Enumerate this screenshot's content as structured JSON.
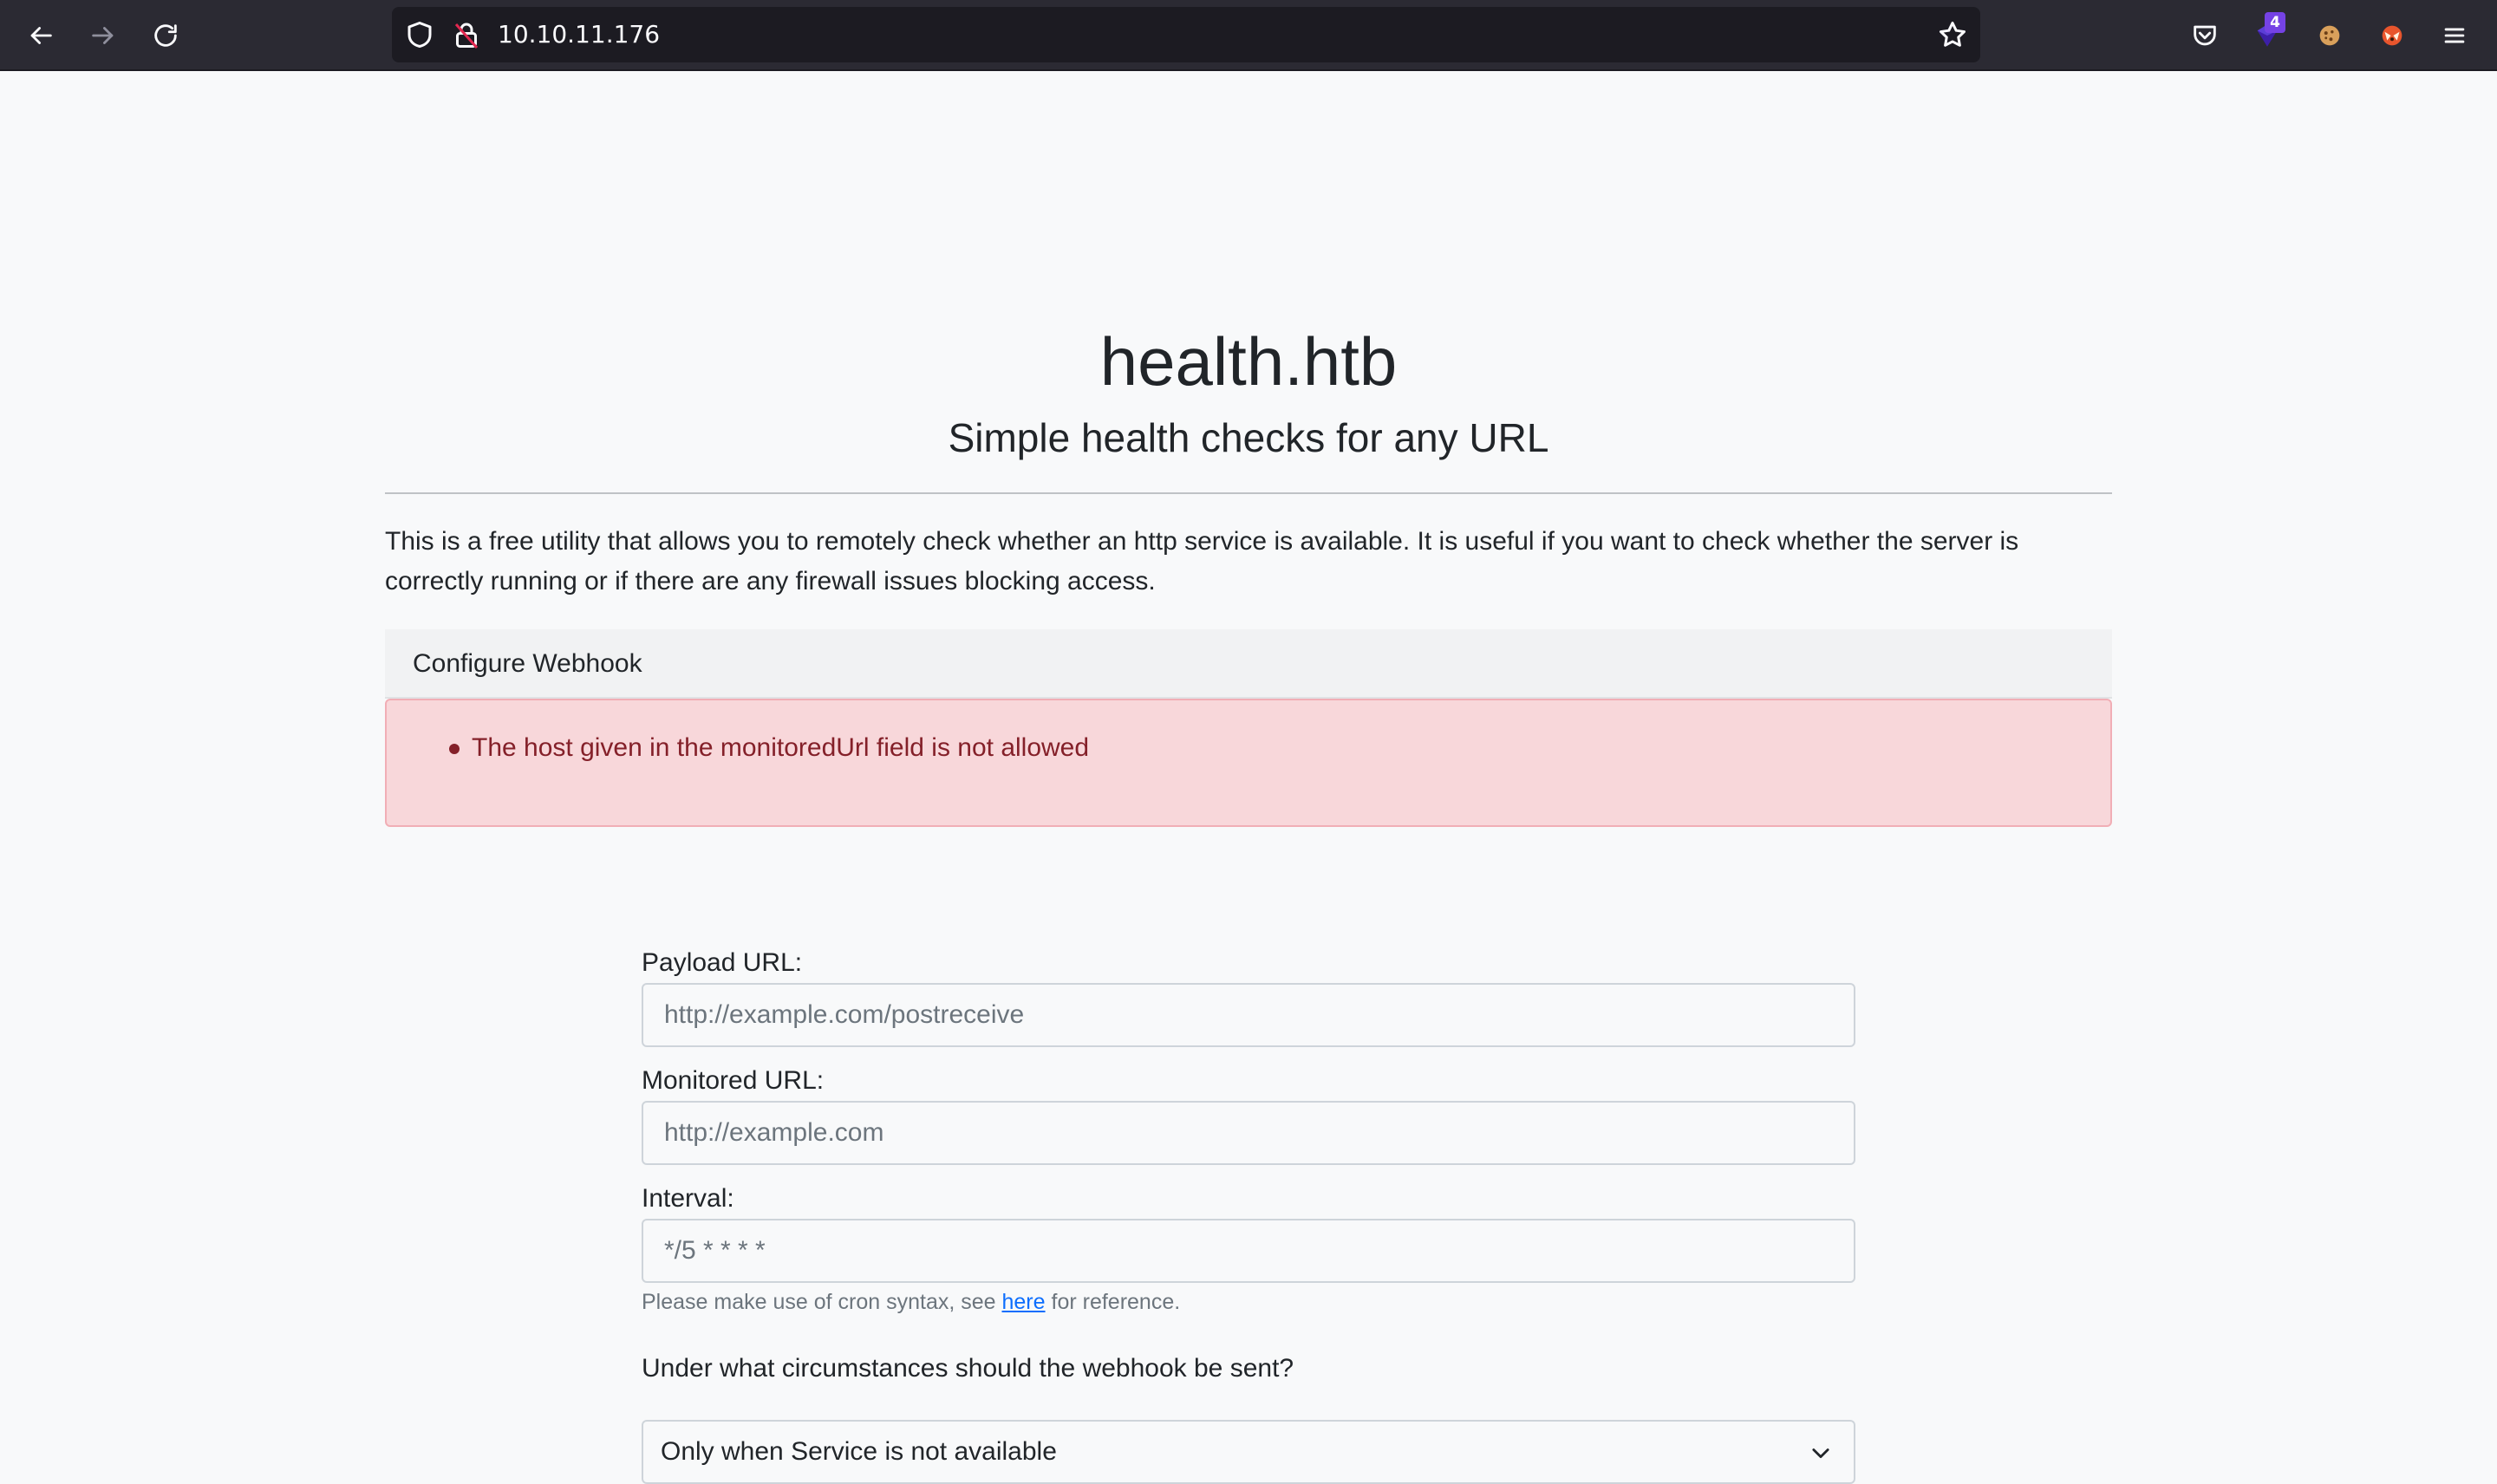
{
  "browser": {
    "url": "10.10.11.176",
    "extension_badge": "4",
    "icons": {
      "back": "back-arrow-icon",
      "forward": "forward-arrow-icon",
      "reload": "reload-icon",
      "tracking": "shield-icon",
      "security": "lock-icon",
      "bookmark": "star-icon",
      "pocket": "pocket-icon",
      "extension": "extension-icon",
      "cookie": "cookie-icon",
      "extension2": "fox-icon",
      "menu": "hamburger-menu-icon"
    }
  },
  "page": {
    "title": "health.htb",
    "subtitle": "Simple health checks for any URL",
    "intro": "This is a free utility that allows you to remotely check whether an http service is available. It is useful if you want to check whether the server is correctly running or if there are any firewall issues blocking access.",
    "card_header": "Configure Webhook",
    "alert_message": "The host given in the monitoredUrl field is not allowed"
  },
  "form": {
    "payload_label": "Payload URL:",
    "payload_placeholder": "http://example.com/postreceive",
    "monitored_label": "Monitored URL:",
    "monitored_placeholder": "http://example.com",
    "interval_label": "Interval:",
    "interval_placeholder": "*/5 * * * *",
    "help_prefix": "Please make use of cron syntax, see",
    "help_link": "here",
    "help_suffix": "for reference.",
    "circumstances_label": "Under what circumstances should the webhook be sent?",
    "circumstances_selected": "Only when Service is not available"
  }
}
